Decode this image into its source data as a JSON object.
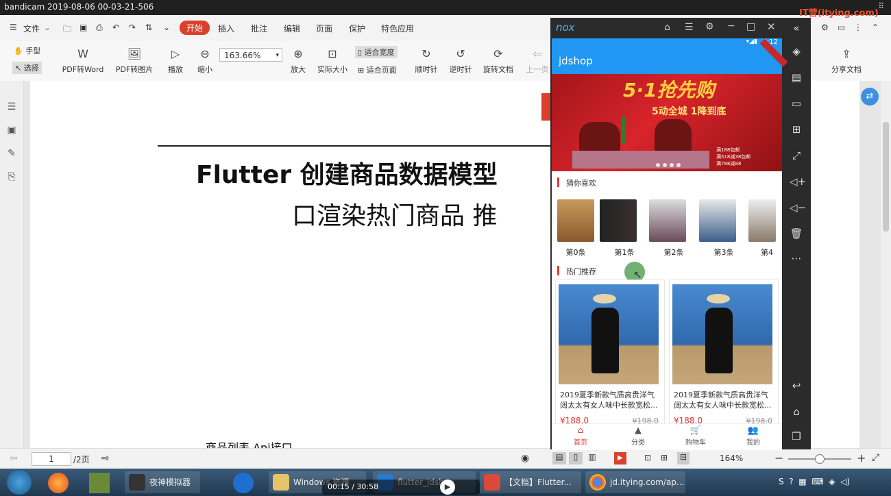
{
  "recorder": {
    "title": "bandicam 2019-08-06 00-03-21-506"
  },
  "menu": {
    "file": "文件",
    "items": [
      "开始",
      "插入",
      "批注",
      "编辑",
      "页面",
      "保护",
      "特色应用"
    ],
    "active": "开始"
  },
  "toolbar": {
    "hand": "手型",
    "select": "选择",
    "pdf_word": "PDF转Word",
    "pdf_image": "PDF转图片",
    "play": "播放",
    "zoom_out": "缩小",
    "zoom_value": "163.66%",
    "zoom_in": "放大",
    "actual_size": "实际大小",
    "fit_width": "适合宽度",
    "fit_page": "适合页面",
    "rotate_cw": "顺时针",
    "rotate_ccw": "逆时针",
    "rotate_doc": "旋转文档",
    "prev_page": "上一页",
    "share_doc": "分享文档"
  },
  "watermark": "IT营(itying.com)",
  "document": {
    "title_line1": "Flutter 创建商品数据模型",
    "title_line2": "口渲染热门商品  推",
    "footer_text": "商品列表 Api接口"
  },
  "statusbar": {
    "page_input": "1",
    "page_total": "/2页",
    "zoom": "164%"
  },
  "emulator": {
    "brand": "nox",
    "time": "6:12",
    "app_title": "jdshop",
    "banner": {
      "headline": "5·1抢先购",
      "subline": "5动全城 1降到底",
      "prices": [
        "满188包邮",
        "满518减38包邮",
        "满788减88"
      ]
    },
    "section_like": "猜你喜欢",
    "thumbs": [
      "第0条",
      "第1条",
      "第2条",
      "第3条",
      "第4"
    ],
    "section_hot": "热门推荐",
    "products": [
      {
        "title": "2019夏季新款气质高贵洋气阔太太有女人味中长款宽松...",
        "price": "¥188.0",
        "old_price": "¥198.0"
      },
      {
        "title": "2019夏季新款气质高贵洋气阔太太有女人味中长款宽松...",
        "price": "¥188.0",
        "old_price": "¥198.0"
      }
    ],
    "nav": [
      "首页",
      "分类",
      "购物车",
      "我的"
    ]
  },
  "taskbar": {
    "apps": [
      "夜神模拟器",
      "Windows 资源",
      "flutter_jdshop",
      "【文档】Flutter...",
      "jd.itying.com/ap..."
    ],
    "media_time": "00:15 / 30:58"
  },
  "colors": {
    "accent_red": "#d9412e",
    "app_blue": "#2196f3",
    "price_red": "#e53935"
  }
}
